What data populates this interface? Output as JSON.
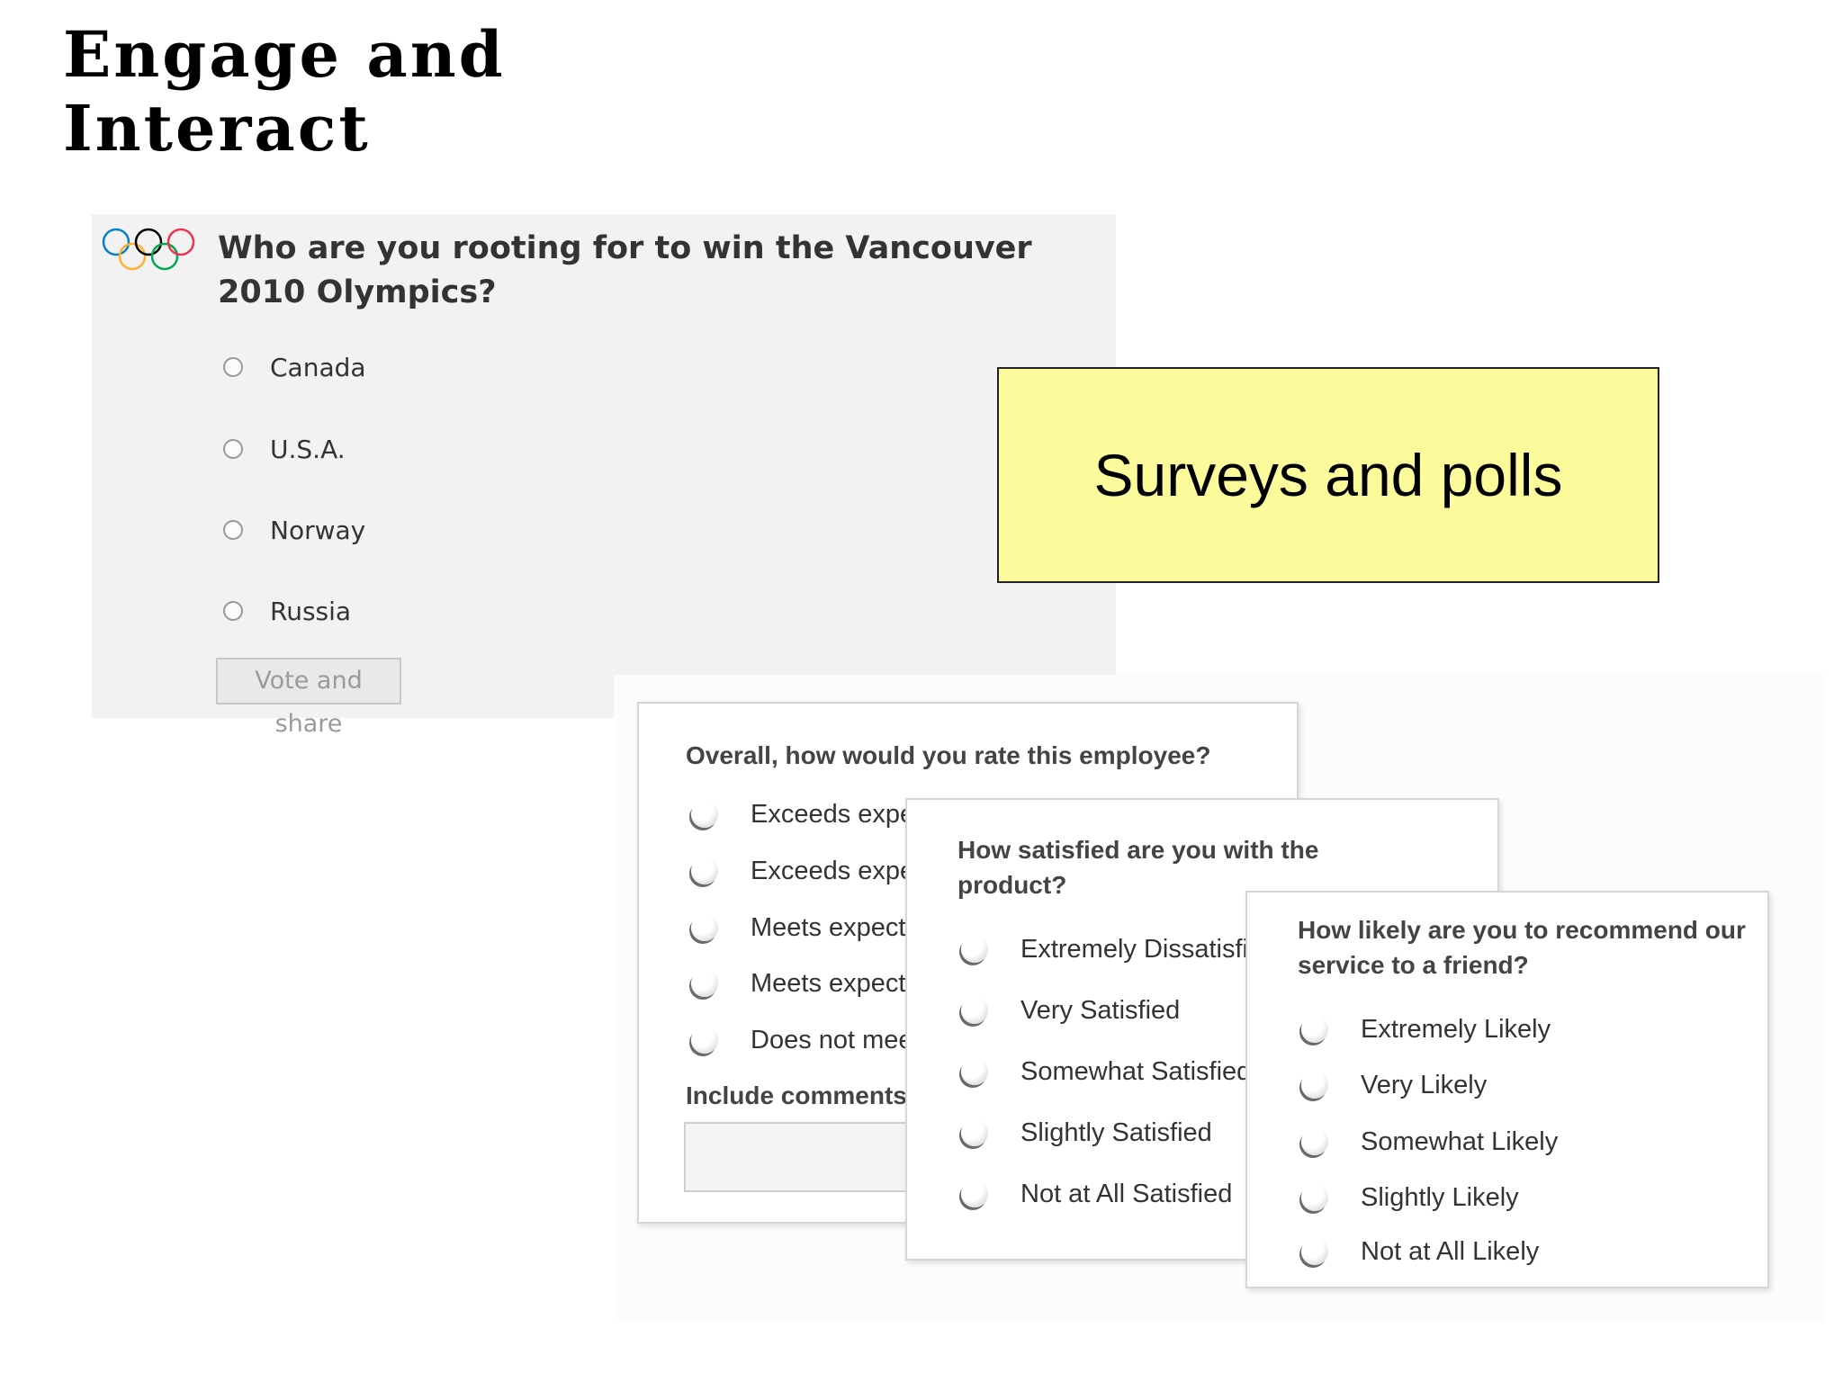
{
  "slide": {
    "title_line1": "Engage and",
    "title_line2": "Interact"
  },
  "poll": {
    "question": "Who are you rooting for to win the Vancouver 2010 Olympics?",
    "options": [
      "Canada",
      "U.S.A.",
      "Norway",
      "Russia"
    ],
    "vote_button": "Vote and share",
    "ring_colors": [
      "#0081c8",
      "#fcb131",
      "#000000",
      "#00a651",
      "#ee334e"
    ]
  },
  "callout": {
    "text": "Surveys and polls",
    "background": "#fbfb9b"
  },
  "employee_survey": {
    "question": "Overall, how would you rate this employee?",
    "options": [
      "Exceeds expe",
      "Exceeds expe",
      "Meets expecta",
      "Meets expecta",
      "Does not mee"
    ],
    "comments_label": "Include comments",
    "comments_value": ""
  },
  "satisfaction_survey": {
    "question": "How satisfied are you with the product?",
    "options": [
      "Extremely Dissatisfi",
      "Very Satisfied",
      "Somewhat Satisfied",
      "Slightly Satisfied",
      "Not at All Satisfied"
    ]
  },
  "recommend_survey": {
    "question": "How likely are you to recommend our service to a friend?",
    "options": [
      "Extremely Likely",
      "Very Likely",
      "Somewhat Likely",
      "Slightly Likely",
      "Not at All Likely"
    ]
  }
}
